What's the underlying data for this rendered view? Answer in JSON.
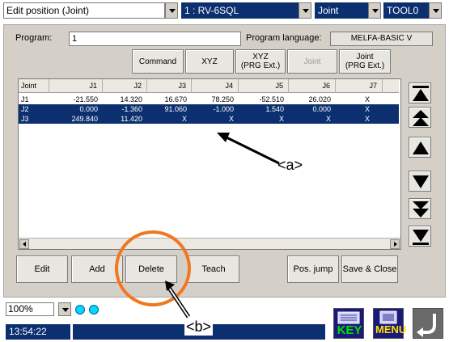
{
  "topbar": {
    "mode_select": "Edit position (Joint)",
    "robot_select": "1 : RV-6SQL",
    "coord_select": "Joint",
    "tool_select": "TOOL0"
  },
  "program": {
    "label": "Program:",
    "value": "1",
    "language_label": "Program language:",
    "language_value": "MELFA-BASIC V"
  },
  "view_buttons": {
    "command": "Command",
    "xyz": "XYZ",
    "xyz_ext": "XYZ\n(PRG Ext.)",
    "joint": "Joint",
    "joint_ext": "Joint\n(PRG Ext.)"
  },
  "table": {
    "columns": [
      "Joint",
      "J1",
      "J2",
      "J3",
      "J4",
      "J5",
      "J6",
      "J7"
    ],
    "rows": [
      {
        "cells": [
          "J1",
          "-21.550",
          "14.320",
          "16.670",
          "78.250",
          "-52.510",
          "26.020",
          "X"
        ],
        "selected": false
      },
      {
        "cells": [
          "J2",
          "0.000",
          "-1.360",
          "91.060",
          "-1.000",
          "1.540",
          "0.000",
          "X"
        ],
        "selected": true
      },
      {
        "cells": [
          "J3",
          "249.840",
          "11.420",
          "X",
          "X",
          "X",
          "X",
          "X"
        ],
        "selected": true
      }
    ]
  },
  "action_buttons": {
    "edit": "Edit",
    "add": "Add",
    "delete": "Delete",
    "teach": "Teach",
    "pos_jump": "Pos. jump",
    "save_close": "Save & Close"
  },
  "status": {
    "zoom": "100%",
    "time": "13:54:22"
  },
  "icons": {
    "key": "KEY",
    "menu": "MENU"
  },
  "annotations": {
    "a": "<a>",
    "b": "<b>"
  },
  "colors": {
    "selection": "#0b2f6f",
    "callout_circle": "#f07820",
    "key_text": "#00e000",
    "menu_text": "#ffe000"
  }
}
